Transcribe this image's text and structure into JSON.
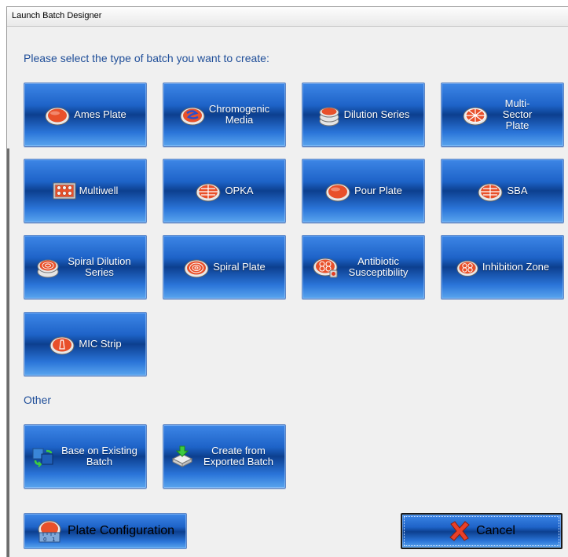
{
  "window": {
    "title": "Launch Batch Designer"
  },
  "prompt": "Please select the type of batch you want to create:",
  "batch_types": [
    {
      "label": "Ames Plate",
      "icon": "ames-plate-icon"
    },
    {
      "label": "Chromogenic Media",
      "icon": "chromogenic-media-icon"
    },
    {
      "label": "Dilution Series",
      "icon": "dilution-series-icon"
    },
    {
      "label": "Multi-Sector Plate",
      "icon": "multi-sector-plate-icon"
    },
    {
      "label": "Multiwell",
      "icon": "multiwell-icon"
    },
    {
      "label": "OPKA",
      "icon": "opka-icon"
    },
    {
      "label": "Pour Plate",
      "icon": "pour-plate-icon"
    },
    {
      "label": "SBA",
      "icon": "sba-icon"
    },
    {
      "label": "Spiral Dilution Series",
      "icon": "spiral-dilution-series-icon"
    },
    {
      "label": "Spiral Plate",
      "icon": "spiral-plate-icon"
    },
    {
      "label": "Antibiotic Susceptibility",
      "icon": "antibiotic-susceptibility-icon"
    },
    {
      "label": "Inhibition Zone",
      "icon": "inhibition-zone-icon"
    },
    {
      "label": "MIC Strip",
      "icon": "mic-strip-icon"
    }
  ],
  "other_label": "Other",
  "other_types": [
    {
      "label": "Base on Existing Batch",
      "icon": "copy-batch-icon"
    },
    {
      "label": "Create from Exported Batch",
      "icon": "import-batch-icon"
    }
  ],
  "footer": {
    "plate_config_label": "Plate Configuration",
    "cancel_label": "Cancel"
  },
  "colors": {
    "heading": "#1f4e99",
    "button_top": "#3d86e6",
    "button_mid": "#0c3f8f",
    "button_bottom": "#5aa5ee",
    "plate_red": "#e8502a"
  }
}
